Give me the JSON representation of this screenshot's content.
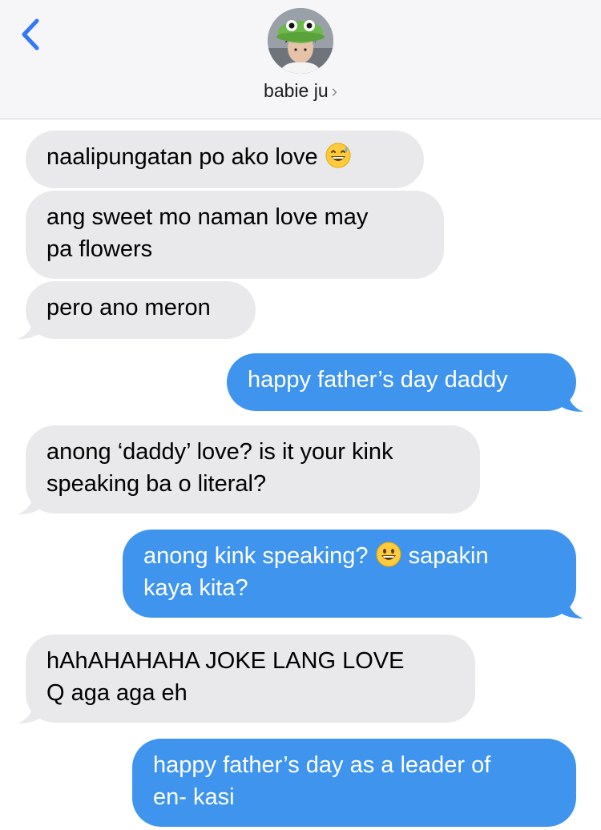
{
  "header": {
    "contact_name": "babie ju",
    "chevron": "›",
    "back_icon": "chevron-left-icon",
    "accent_color": "#3478F6"
  },
  "messages": [
    {
      "direction": "incoming",
      "text": "naalipungatan po ako love",
      "emoji": "grinning-sweat-emoji"
    },
    {
      "direction": "incoming",
      "line1": "ang sweet mo naman love may",
      "line2": "pa flowers"
    },
    {
      "direction": "incoming",
      "text": "pero ano meron"
    },
    {
      "direction": "outgoing",
      "text": "happy father’s day daddy"
    },
    {
      "direction": "incoming",
      "line1": "anong ‘daddy’ love? is it your kink",
      "line2": "speaking ba o literal?"
    },
    {
      "direction": "outgoing",
      "line1a": "anong kink speaking?",
      "line1b": "sapakin",
      "emoji": "grinning-emoji",
      "line2": "kaya kita?"
    },
    {
      "direction": "incoming",
      "line1": "hAhAHAHAHA JOKE LANG LOVE",
      "line2": "Q aga aga eh"
    },
    {
      "direction": "outgoing",
      "line1": "happy father’s day as a leader of",
      "line2": "en- kasi"
    }
  ],
  "colors": {
    "incoming_bubble": "#E9E9EB",
    "outgoing_bubble": "#3F94EE"
  }
}
